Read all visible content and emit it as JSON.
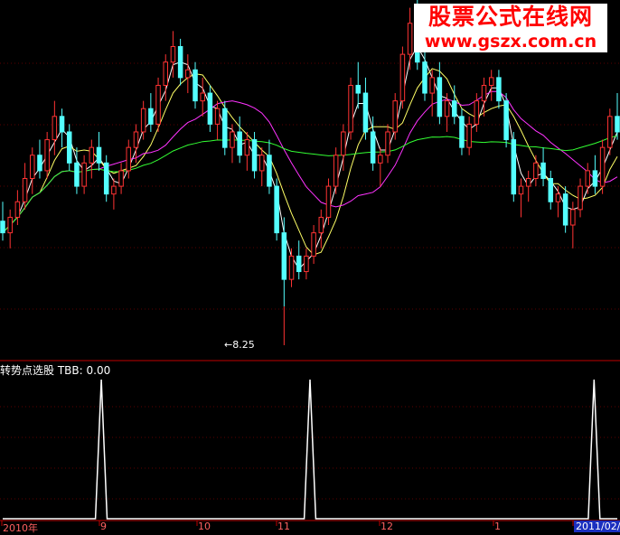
{
  "watermark": {
    "line1": "股票公式在线网",
    "line2": "www.gszx.com.cn"
  },
  "indicator": {
    "name": "转势点选股",
    "series": "TBB",
    "value": "0.00"
  },
  "low_marker": "8.25",
  "x_axis_labels": [
    "2010年",
    "9",
    "10",
    "11",
    "12",
    "1",
    "2011/02/2"
  ],
  "colors": {
    "background": "#000000",
    "grid": "#5a0000",
    "divider": "#c00000",
    "up_candle": "#ff3333",
    "down_candle": "#54ffff",
    "ma_short": "#ffffff",
    "ma_mid": "#ffff66",
    "ma_long": "#ff33ff",
    "ma_longest": "#33ff33",
    "signal": "#ffffff"
  },
  "chart_data": [
    {
      "type": "candlestick",
      "title": "",
      "price_range": [
        7.6,
        12.2
      ],
      "low_annotation": 8.25,
      "candles": [
        [
          9.35,
          9.6,
          9.1,
          9.2
        ],
        [
          9.2,
          9.5,
          9.0,
          9.4
        ],
        [
          9.4,
          9.75,
          9.3,
          9.6
        ],
        [
          9.6,
          10.1,
          9.5,
          9.9
        ],
        [
          9.9,
          10.3,
          9.7,
          10.2
        ],
        [
          10.2,
          10.4,
          9.9,
          10.0
        ],
        [
          10.0,
          10.5,
          9.9,
          10.4
        ],
        [
          10.4,
          10.9,
          10.2,
          10.7
        ],
        [
          10.7,
          10.8,
          10.3,
          10.5
        ],
        [
          10.5,
          10.6,
          10.0,
          10.1
        ],
        [
          10.1,
          10.3,
          9.7,
          9.8
        ],
        [
          9.8,
          10.2,
          9.7,
          10.1
        ],
        [
          10.1,
          10.4,
          9.9,
          10.3
        ],
        [
          10.3,
          10.5,
          10.0,
          10.1
        ],
        [
          10.1,
          10.2,
          9.6,
          9.7
        ],
        [
          9.7,
          9.9,
          9.5,
          9.8
        ],
        [
          9.8,
          10.1,
          9.7,
          10.0
        ],
        [
          10.0,
          10.4,
          9.9,
          10.3
        ],
        [
          10.3,
          10.6,
          10.1,
          10.5
        ],
        [
          10.5,
          10.9,
          10.4,
          10.8
        ],
        [
          10.8,
          11.0,
          10.5,
          10.6
        ],
        [
          10.6,
          11.2,
          10.5,
          11.1
        ],
        [
          11.1,
          11.5,
          10.9,
          11.4
        ],
        [
          11.4,
          11.8,
          11.2,
          11.6
        ],
        [
          11.6,
          11.7,
          11.1,
          11.2
        ],
        [
          11.2,
          11.5,
          11.0,
          11.3
        ],
        [
          11.3,
          11.4,
          10.8,
          10.9
        ],
        [
          10.9,
          11.2,
          10.7,
          11.0
        ],
        [
          11.0,
          11.1,
          10.5,
          10.6
        ],
        [
          10.6,
          10.9,
          10.4,
          10.8
        ],
        [
          10.8,
          10.9,
          10.2,
          10.3
        ],
        [
          10.3,
          10.6,
          10.1,
          10.5
        ],
        [
          10.5,
          10.7,
          10.1,
          10.2
        ],
        [
          10.2,
          10.5,
          10.0,
          10.4
        ],
        [
          10.4,
          10.5,
          9.9,
          10.0
        ],
        [
          10.0,
          10.3,
          9.8,
          10.2
        ],
        [
          10.2,
          10.4,
          9.7,
          9.8
        ],
        [
          9.8,
          9.9,
          9.1,
          9.2
        ],
        [
          9.2,
          9.4,
          8.25,
          8.6
        ],
        [
          8.6,
          9.0,
          8.5,
          8.9
        ],
        [
          8.9,
          9.1,
          8.6,
          8.7
        ],
        [
          8.7,
          9.0,
          8.6,
          8.9
        ],
        [
          8.9,
          9.3,
          8.8,
          9.2
        ],
        [
          9.2,
          9.5,
          9.0,
          9.4
        ],
        [
          9.4,
          9.9,
          9.3,
          9.8
        ],
        [
          9.8,
          10.3,
          9.7,
          10.2
        ],
        [
          10.2,
          10.6,
          10.0,
          10.5
        ],
        [
          10.5,
          11.2,
          10.4,
          11.1
        ],
        [
          11.1,
          11.4,
          10.8,
          11.0
        ],
        [
          11.0,
          11.2,
          10.4,
          10.5
        ],
        [
          10.5,
          10.7,
          10.0,
          10.1
        ],
        [
          10.1,
          10.3,
          9.8,
          10.2
        ],
        [
          10.2,
          10.6,
          10.1,
          10.5
        ],
        [
          10.5,
          11.0,
          10.4,
          10.9
        ],
        [
          10.9,
          11.6,
          10.8,
          11.5
        ],
        [
          11.5,
          12.1,
          11.3,
          11.9
        ],
        [
          11.9,
          12.2,
          11.3,
          11.4
        ],
        [
          11.4,
          11.6,
          10.9,
          11.0
        ],
        [
          11.0,
          11.3,
          10.7,
          11.2
        ],
        [
          11.2,
          11.4,
          10.6,
          10.7
        ],
        [
          10.7,
          11.0,
          10.5,
          10.9
        ],
        [
          10.9,
          11.1,
          10.6,
          10.7
        ],
        [
          10.7,
          10.8,
          10.2,
          10.3
        ],
        [
          10.3,
          10.7,
          10.2,
          10.6
        ],
        [
          10.6,
          11.0,
          10.5,
          10.9
        ],
        [
          10.9,
          11.2,
          10.7,
          11.1
        ],
        [
          11.1,
          11.3,
          10.9,
          11.2
        ],
        [
          11.2,
          11.3,
          10.8,
          10.9
        ],
        [
          10.9,
          11.0,
          10.3,
          10.4
        ],
        [
          10.4,
          10.5,
          9.6,
          9.7
        ],
        [
          9.7,
          9.9,
          9.4,
          9.8
        ],
        [
          9.8,
          10.0,
          9.6,
          9.9
        ],
        [
          9.9,
          10.2,
          9.8,
          10.1
        ],
        [
          10.1,
          10.3,
          9.8,
          9.9
        ],
        [
          9.9,
          10.0,
          9.5,
          9.6
        ],
        [
          9.6,
          9.8,
          9.4,
          9.7
        ],
        [
          9.7,
          9.8,
          9.2,
          9.3
        ],
        [
          9.3,
          9.6,
          9.0,
          9.5
        ],
        [
          9.5,
          9.9,
          9.4,
          9.8
        ],
        [
          9.8,
          10.1,
          9.7,
          10.0
        ],
        [
          10.0,
          10.2,
          9.7,
          9.8
        ],
        [
          9.8,
          10.4,
          9.7,
          10.3
        ],
        [
          10.3,
          10.8,
          10.2,
          10.7
        ],
        [
          10.7,
          11.0,
          10.4,
          10.5
        ]
      ],
      "moving_averages": [
        "ma_short",
        "ma_mid",
        "ma_long",
        "ma_longest"
      ]
    },
    {
      "type": "line",
      "title": "转势点选股",
      "series": [
        {
          "name": "TBB",
          "last_value": 0.0
        }
      ],
      "signal_indices": [
        17,
        53,
        102
      ],
      "total_bars": 107,
      "ylim": [
        0,
        1
      ]
    }
  ]
}
